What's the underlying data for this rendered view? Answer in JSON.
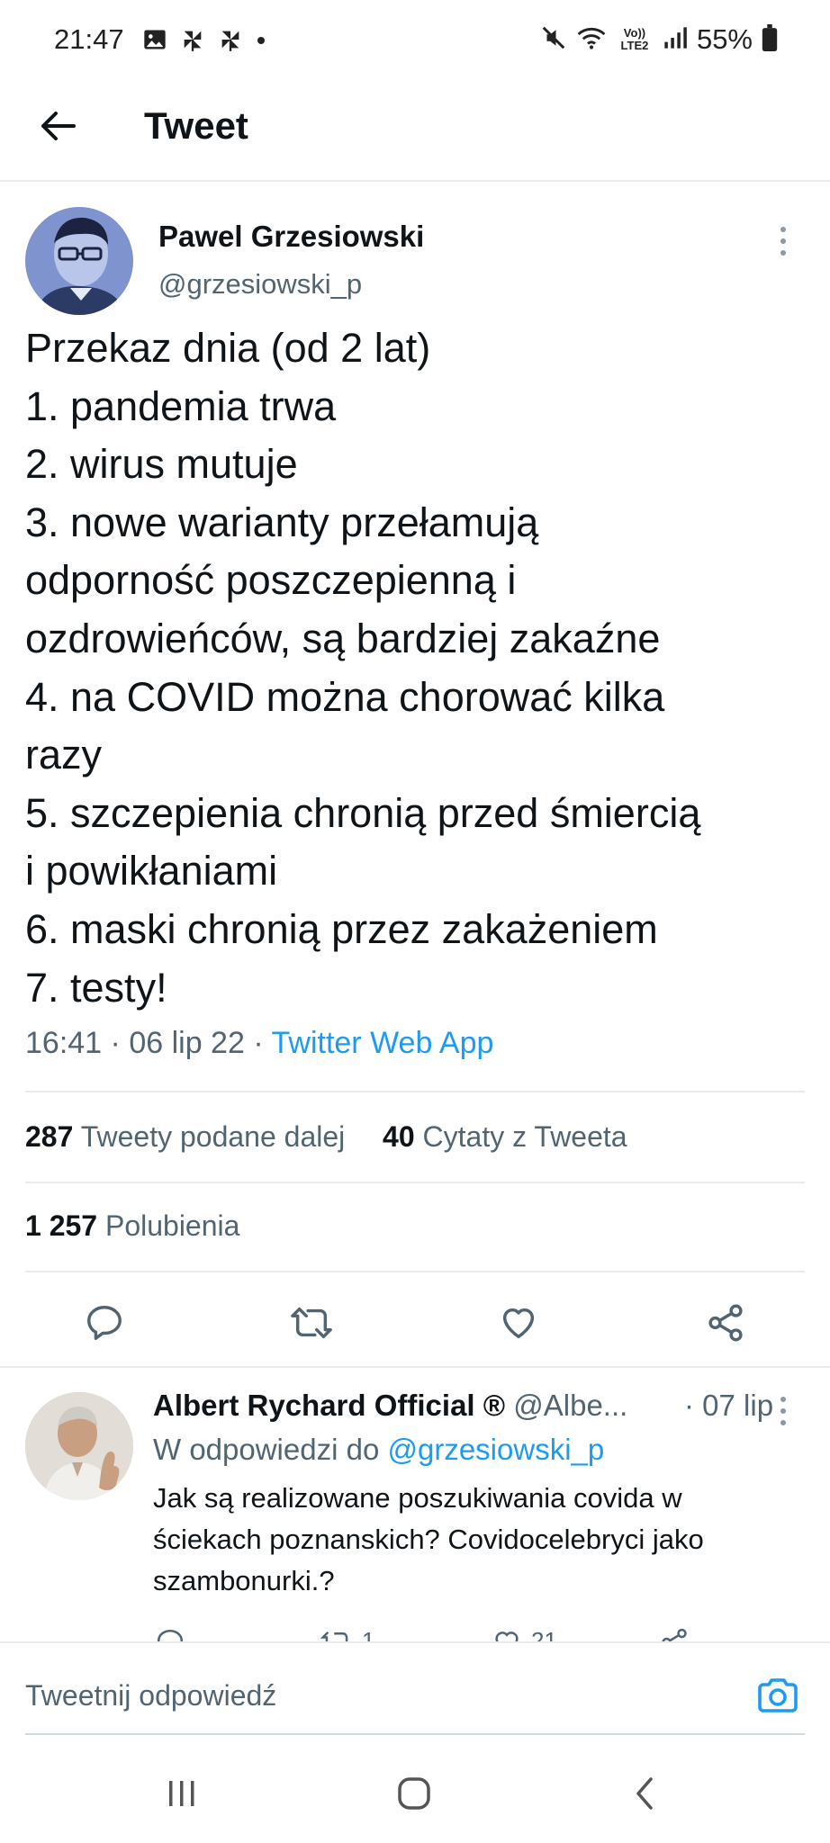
{
  "status_bar": {
    "time": "21:47",
    "left_icons": [
      "image-icon",
      "pinwheel-icon",
      "pinwheel-icon",
      "dot-icon"
    ],
    "right_icons": [
      "mute-icon",
      "wifi-icon",
      "volte-icon",
      "signal-icon",
      "battery-icon"
    ],
    "volte_label": "Vo)) LTE2",
    "battery_percent": "55%"
  },
  "header": {
    "title": "Tweet"
  },
  "tweet": {
    "author_name": "Pawel Grzesiowski",
    "author_handle": "@grzesiowski_p",
    "lines": [
      "Przekaz dnia (od 2 lat)",
      "1. pandemia trwa",
      "2. wirus mutuje",
      "3. nowe warianty przełamują",
      "odporność poszczepienną i",
      "ozdrowieńców, są bardziej zakaźne",
      "4. na COVID można chorować kilka",
      "razy",
      "5. szczepienia chronią przed śmiercią",
      "i powikłaniami",
      "6. maski chronią przez zakażeniem",
      "7. testy!"
    ],
    "time": "16:41",
    "date": "06 lip 22",
    "separator": "·",
    "source": "Twitter Web App",
    "retweets_count": "287",
    "retweets_label": "Tweety podane dalej",
    "quotes_count": "40",
    "quotes_label": "Cytaty z Tweeta",
    "likes_count": "1 257",
    "likes_label": "Polubienia"
  },
  "reply": {
    "author_name": "Albert Rychard Official ®",
    "author_handle": "@Albe...",
    "date": "· 07 lip",
    "reply_to_prefix": "W odpowiedzi do",
    "reply_to_handle": "@grzesiowski_p",
    "lines": [
      "Jak są realizowane poszukiwania covida w",
      "ściekach poznanskich? Covidocelebryci jako",
      "szambonurki.?"
    ],
    "retweets_count": "1",
    "likes_count": "21"
  },
  "compose": {
    "placeholder": "Tweetnij odpowiedź"
  },
  "nav": {
    "buttons": [
      "recent-apps-icon",
      "home-icon",
      "back-icon"
    ]
  },
  "colors": {
    "accent": "#1d9bf0",
    "text_primary": "#0f1419",
    "text_secondary": "#536471",
    "divider": "#e6ecf0"
  }
}
